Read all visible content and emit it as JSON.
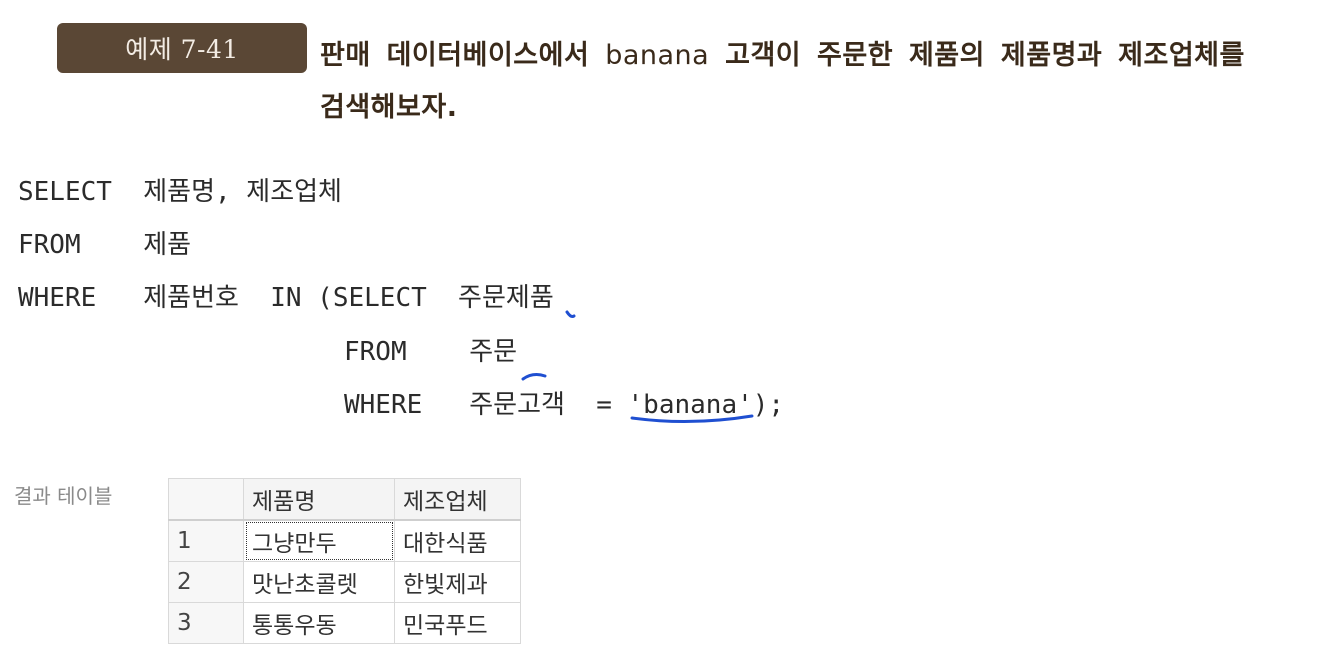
{
  "example": {
    "badge": "예제 7-41",
    "line1_a": "판매 데이터베이스에서",
    "line1_latin": "banana",
    "line1_b": "고객이 주문한 제품의 제품명과 제조업체를",
    "line2": "검색해보자."
  },
  "sql": {
    "line1": "SELECT  제품명, 제조업체",
    "line2": "FROM    제품",
    "line3": "WHERE   제품번호  IN (SELECT  주문제품",
    "line4": "FROM    주문",
    "line5": "WHERE   주문고객  = 'banana');"
  },
  "result": {
    "label": "결과 테이블",
    "headers": [
      "",
      "제품명",
      "제조업체"
    ],
    "rows": [
      [
        "1",
        "그냥만두",
        "대한식품"
      ],
      [
        "2",
        "맛난초콜렛",
        "한빛제과"
      ],
      [
        "3",
        "통통우동",
        "민국푸드"
      ]
    ]
  },
  "colors": {
    "badge_bg": "#5a4735",
    "annotation": "#1f4fd1"
  }
}
